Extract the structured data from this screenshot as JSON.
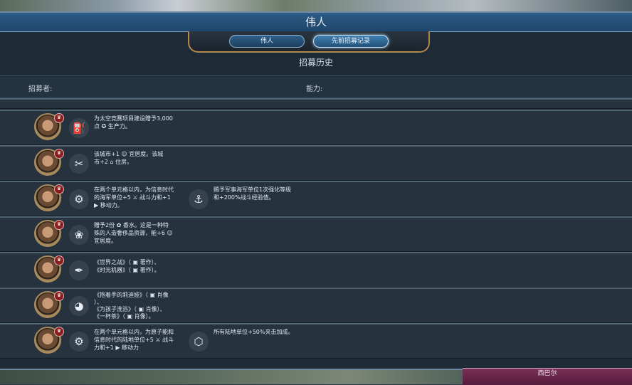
{
  "window": {
    "title": "伟人"
  },
  "tabs": [
    {
      "label": "伟人",
      "selected": false
    },
    {
      "label": "先前招募记录",
      "selected": true
    }
  ],
  "section_title": "招募历史",
  "columns": {
    "recruiter": "招募者:",
    "ability": "能力:"
  },
  "rows": [
    {
      "effects": [
        {
          "icon": "spaceport-icon",
          "lines": [
            "为太空竞赛项目建设赠予3,000",
            "点 ✪ 生产力。"
          ]
        }
      ]
    },
    {
      "effects": [
        {
          "icon": "tools-icon",
          "lines": [
            "该城市+1 ☺ 宜居度。该城",
            "市+2 ⌂ 住房。"
          ]
        }
      ]
    },
    {
      "effects": [
        {
          "icon": "cog-icon",
          "lines": [
            "在两个单元格以内，为信息时代",
            "的海军单位+5 ⚔ 战斗力和+1",
            "▶ 移动力。"
          ]
        },
        {
          "icon": "anchor-icon",
          "lines": [
            "赐予军事海军单位1次强化等级",
            "和+200%战斗经验值。"
          ]
        }
      ]
    },
    {
      "effects": [
        {
          "icon": "perfume-icon",
          "lines": [
            "赠予2份 ✿ 香水。这是一种特",
            "殊的人造奢侈品资源，能+6 ☺",
            "宜居度。"
          ]
        }
      ]
    },
    {
      "effects": [
        {
          "icon": "quill-icon",
          "lines": [
            "《世界之战》（ ▣ 著作）、",
            "《时光机器》（ ▣ 著作）。"
          ]
        }
      ]
    },
    {
      "effects": [
        {
          "icon": "palette-icon",
          "lines": [
            "《抱着手的莉迪娅》（ ▣ 肖像",
            "）、",
            "《为孩子洗浴》（ ▣ 肖像）、",
            "《一杯茶》（ ▣ 肖像）。"
          ]
        }
      ]
    },
    {
      "effects": [
        {
          "icon": "cog-icon",
          "lines": [
            "在两个单元格以内，为原子能和",
            "信息时代的陆地单位+5 ⚔ 战斗",
            "力和+1 ▶ 移动力"
          ]
        },
        {
          "icon": "crate-icon",
          "lines": [
            "所有陆地单位+50%夹击加成。"
          ]
        }
      ]
    }
  ],
  "bottom_hud": {
    "label": "西巴尔"
  }
}
